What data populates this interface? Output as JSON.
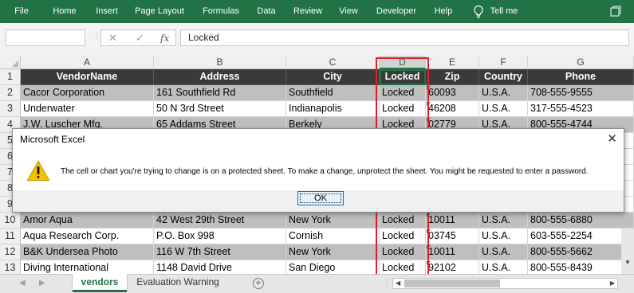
{
  "ribbon": {
    "tabs": [
      "File",
      "Home",
      "Insert",
      "Page Layout",
      "Formulas",
      "Data",
      "Review",
      "View",
      "Developer",
      "Help"
    ],
    "tell_me": "Tell me"
  },
  "formula_bar": {
    "name_box": "",
    "fx_label": "fx",
    "value": "Locked"
  },
  "columns": [
    "A",
    "B",
    "C",
    "D",
    "E",
    "F",
    "G"
  ],
  "selected_column": "D",
  "header_row": {
    "row_number": "1",
    "cells": [
      "VendorName",
      "Address",
      "City",
      "Locked",
      "Zip",
      "Country",
      "Phone"
    ]
  },
  "rows": [
    {
      "n": "2",
      "cells": [
        "Cacor Corporation",
        "161 Southfield Rd",
        "Southfield",
        "Locked",
        "60093",
        "U.S.A.",
        "708-555-9555"
      ]
    },
    {
      "n": "3",
      "cells": [
        "Underwater",
        "50 N 3rd Street",
        "Indianapolis",
        "Locked",
        "46208",
        "U.S.A.",
        "317-555-4523"
      ]
    },
    {
      "n": "4",
      "cells": [
        "J.W.  Luscher Mfg.",
        "65 Addams Street",
        "Berkely",
        "Locked",
        "02779",
        "U.S.A.",
        "800-555-4744"
      ]
    },
    {
      "n": "5",
      "cells": [
        "",
        "",
        "",
        "",
        "",
        "",
        ""
      ]
    },
    {
      "n": "6",
      "cells": [
        "",
        "",
        "",
        "",
        "",
        "",
        ""
      ]
    },
    {
      "n": "7",
      "cells": [
        "",
        "",
        "",
        "",
        "",
        "",
        ""
      ]
    },
    {
      "n": "8",
      "cells": [
        "",
        "",
        "",
        "",
        "",
        "",
        ""
      ]
    },
    {
      "n": "9",
      "cells": [
        "",
        "",
        "",
        "",
        "",
        "",
        ""
      ]
    },
    {
      "n": "10",
      "cells": [
        "Amor Aqua",
        "42 West 29th Street",
        "New York",
        "Locked",
        "10011",
        "U.S.A.",
        "800-555-6880"
      ]
    },
    {
      "n": "11",
      "cells": [
        "Aqua Research Corp.",
        "P.O. Box 998",
        "Cornish",
        "Locked",
        "03745",
        "U.S.A.",
        "603-555-2254"
      ]
    },
    {
      "n": "12",
      "cells": [
        "B&K Undersea Photo",
        "116 W 7th Street",
        "New York",
        "Locked",
        "10011",
        "U.S.A.",
        "800-555-5662"
      ]
    },
    {
      "n": "13",
      "cells": [
        "Diving International",
        "1148 David Drive",
        "San Diego",
        "Locked",
        "92102",
        "U.S.A.",
        "800-555-8439"
      ]
    }
  ],
  "dialog": {
    "title": "Microsoft Excel",
    "close": "✕",
    "message": "The cell or chart you're trying to change is on a protected sheet. To make a change, unprotect the sheet. You might be requested to enter a password.",
    "ok_label": "OK"
  },
  "sheet_tabs": {
    "tabs": [
      "vendors",
      "Evaluation Warning"
    ],
    "active": "vendors",
    "add_symbol": "+"
  },
  "colors": {
    "ribbon": "#217346",
    "header_row_bg": "#3a3a3a",
    "grey_row_bg": "#bfbfbf",
    "highlight_box": "#e0202a"
  }
}
